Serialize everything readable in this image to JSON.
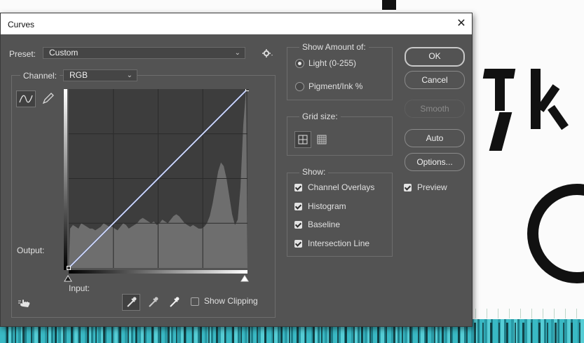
{
  "dialog": {
    "title": "Curves",
    "close_glyph": "✕",
    "preset_label": "Preset:",
    "preset_value": "Custom",
    "channel_label": "Channel:",
    "channel_value": "RGB",
    "output_label": "Output:",
    "input_label": "Input:",
    "show_clipping_label": "Show Clipping",
    "show_clipping_checked": false
  },
  "show_amount": {
    "legend": "Show Amount of:",
    "options": [
      {
        "label": "Light  (0-255)",
        "selected": true
      },
      {
        "label": "Pigment/Ink %",
        "selected": false
      }
    ]
  },
  "grid_size": {
    "legend": "Grid size:",
    "selected": "simple"
  },
  "show": {
    "legend": "Show:",
    "options": [
      {
        "label": "Channel Overlays",
        "checked": true
      },
      {
        "label": "Histogram",
        "checked": true
      },
      {
        "label": "Baseline",
        "checked": true
      },
      {
        "label": "Intersection Line",
        "checked": true
      }
    ]
  },
  "buttons": {
    "ok": "OK",
    "cancel": "Cancel",
    "smooth": "Smooth",
    "auto": "Auto",
    "options": "Options..."
  },
  "preview": {
    "label": "Preview",
    "checked": true
  },
  "curve": {
    "points": [
      [
        0,
        0
      ],
      [
        255,
        255
      ]
    ],
    "histogram": [
      0.22,
      0.24,
      0.23,
      0.22,
      0.25,
      0.24,
      0.23,
      0.22,
      0.22,
      0.21,
      0.22,
      0.23,
      0.25,
      0.24,
      0.23,
      0.23,
      0.22,
      0.21,
      0.23,
      0.25,
      0.24,
      0.22,
      0.23,
      0.24,
      0.25,
      0.27,
      0.28,
      0.27,
      0.26,
      0.25,
      0.26,
      0.24,
      0.25,
      0.27,
      0.26,
      0.25,
      0.27,
      0.29,
      0.3,
      0.29,
      0.27,
      0.25,
      0.24,
      0.23,
      0.24,
      0.23,
      0.22,
      0.22,
      0.23,
      0.25,
      0.29,
      0.36,
      0.45,
      0.54,
      0.59,
      0.57,
      0.5,
      0.4,
      0.3,
      0.24,
      0.27,
      0.45,
      0.8,
      1.0
    ]
  },
  "colors": {
    "dialog_bg": "#535353",
    "curve_line": "#ffffff",
    "baseline": "#6f86d8",
    "histogram": "#6e6e6e",
    "grid_bg": "#3d3d3d"
  }
}
